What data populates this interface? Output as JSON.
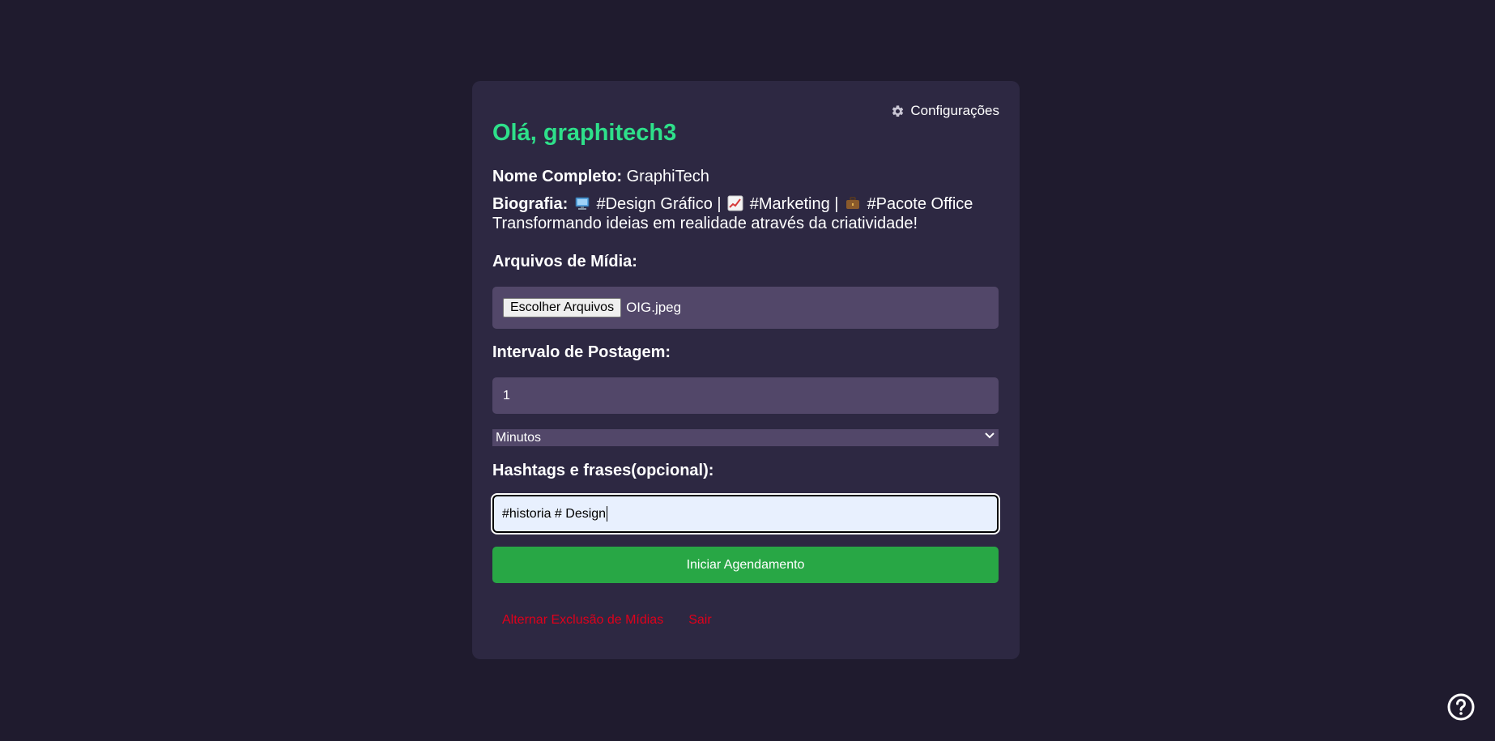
{
  "settings": {
    "label": "Configurações",
    "icon": "gear-icon"
  },
  "header": {
    "greeting": "Olá, graphitech3"
  },
  "profile": {
    "name_label": "Nome Completo:",
    "name_value": "GraphiTech",
    "bio_label": "Biografia:",
    "bio_part1": "#Design Gráfico |",
    "bio_part2": "#Marketing |",
    "bio_part3": "#Pacote Office",
    "bio_line2": "Transformando ideias em realidade através da criatividade!",
    "bio_icons": [
      "computer-emoji",
      "chart-increasing-emoji",
      "briefcase-emoji"
    ]
  },
  "media": {
    "label": "Arquivos de Mídia:",
    "button_label": "Escolher Arquivos",
    "file_name": "OIG.jpeg"
  },
  "interval": {
    "label": "Intervalo de Postagem:",
    "value": "1",
    "unit_selected": "Minutos"
  },
  "hashtags": {
    "label": "Hashtags e frases(opcional):",
    "value": "#historia # Design"
  },
  "actions": {
    "start_label": "Iniciar Agendamento",
    "toggle_delete_label": "Alternar Exclusão de Mídias",
    "logout_label": "Sair"
  },
  "colors": {
    "background": "#1f1b2e",
    "card": "#2d2842",
    "field": "#524769",
    "accent_green": "#2ee08a",
    "button_green": "#28a745",
    "link_red": "#e0001b"
  },
  "help": {
    "icon": "help-circle-icon"
  }
}
